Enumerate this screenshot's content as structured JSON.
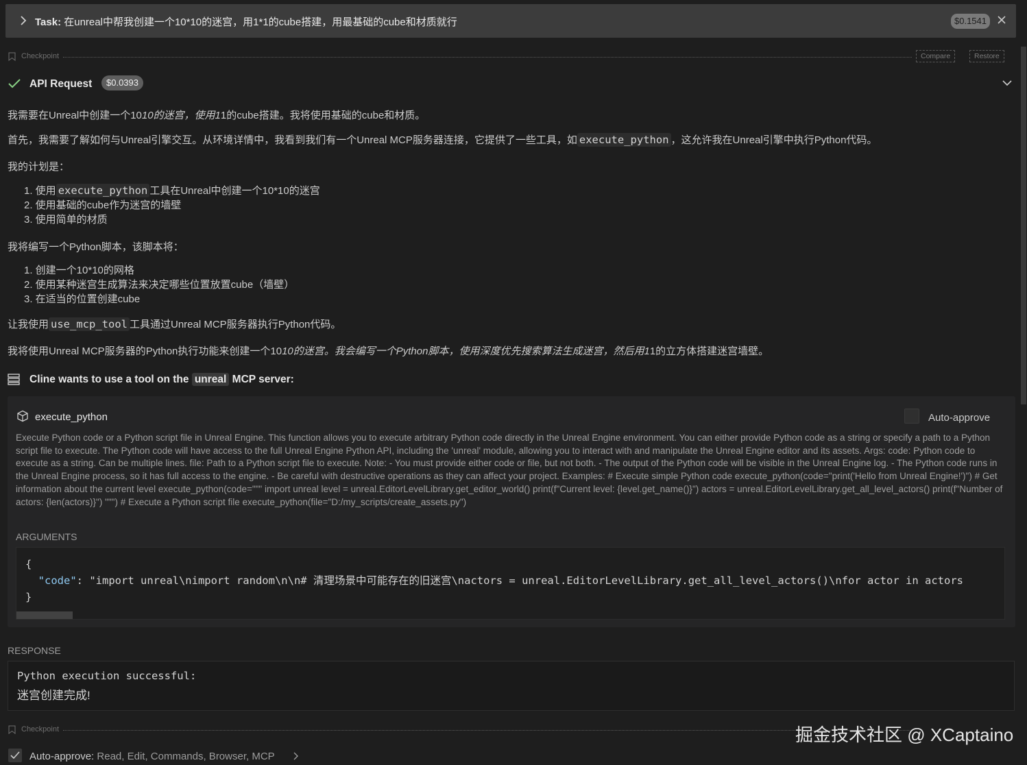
{
  "task": {
    "label": "Task:",
    "text": "在unreal中帮我创建一个10*10的迷宫，用1*1的cube搭建，用最基础的cube和材质就行",
    "cost": "$0.1541"
  },
  "checkpoint": {
    "label": "Checkpoint",
    "compare": "Compare",
    "restore": "Restore"
  },
  "api_request": {
    "title": "API Request",
    "cost": "$0.0393"
  },
  "content": {
    "p1": "我需要在Unreal中创建一个10",
    "p1_italic": "10的迷宫，使用1",
    "p1_end": "1的cube搭建。我将使用基础的cube和材质。",
    "p2_start": "首先，我需要了解如何与Unreal引擎交互。从环境详情中，我看到我们有一个Unreal MCP服务器连接，它提供了一些工具，如",
    "p2_code": "execute_python",
    "p2_end": "，这允许我在Unreal引擎中执行Python代码。",
    "p3": "我的计划是：",
    "plan_1_start": "1. 使用",
    "plan_1_code": "execute_python",
    "plan_1_end": "工具在Unreal中创建一个10*10的迷宫",
    "plan_2": "2. 使用基础的cube作为迷宫的墙壁",
    "plan_3": "3. 使用简单的材质",
    "p4": "我将编写一个Python脚本，该脚本将：",
    "script_1": "1. 创建一个10*10的网格",
    "script_2": "2. 使用某种迷宫生成算法来决定哪些位置放置cube（墙壁）",
    "script_3": "3. 在适当的位置创建cube",
    "p5_start": "让我使用",
    "p5_code": "use_mcp_tool",
    "p5_end": "工具通过Unreal MCP服务器执行Python代码。",
    "p6_start": "我将使用Unreal MCP服务器的Python执行功能来创建一个10",
    "p6_italic": "10的迷宫。我会编写一个Python脚本，使用深度优先搜索算法生成迷宫，然后用1",
    "p6_end": "1的立方体搭建迷宫墙壁。"
  },
  "tool_use": {
    "prefix": "Cline wants to use a tool on the",
    "server": "unreal",
    "suffix": "MCP server:",
    "tool_name": "execute_python",
    "auto_approve_label": "Auto-approve",
    "description": "Execute Python code or a Python script file in Unreal Engine. This function allows you to execute arbitrary Python code directly in the Unreal Engine environment. You can either provide Python code as a string or specify a path to a Python script file to execute. The Python code will have access to the full Unreal Engine Python API, including the 'unreal' module, allowing you to interact with and manipulate the Unreal Engine editor and its assets. Args: code: Python code to execute as a string. Can be multiple lines. file: Path to a Python script file to execute. Note: - You must provide either code or file, but not both. - The output of the Python code will be visible in the Unreal Engine log. - The Python code runs in the Unreal Engine process, so it has full access to the engine. - Be careful with destructive operations as they can affect your project. Examples: # Execute simple Python code execute_python(code=\"print('Hello from Unreal Engine!')\") # Get information about the current level execute_python(code=\"\"\" import unreal level = unreal.EditorLevelLibrary.get_editor_world() print(f\"Current level: {level.get_name()}\") actors = unreal.EditorLevelLibrary.get_all_level_actors() print(f\"Number of actors: {len(actors)}\") \"\"\") # Execute a Python script file execute_python(file=\"D:/my_scripts/create_assets.py\")",
    "arguments_label": "ARGUMENTS",
    "args_open": "{",
    "args_key": "\"code\"",
    "args_value": ": \"import unreal\\nimport random\\n\\n# 清理场景中可能存在的旧迷宫\\nactors = unreal.EditorLevelLibrary.get_all_level_actors()\\nfor actor in actors",
    "args_close": "}"
  },
  "response": {
    "label": "RESPONSE",
    "line1": "Python execution successful:",
    "line2": "迷宫创建完成!"
  },
  "footer": {
    "auto_approve_label": "Auto-approve:",
    "auto_approve_items": "Read, Edit, Commands, Browser, MCP"
  },
  "watermark": "掘金技术社区 @ XCaptaino",
  "colors": {
    "background": "#1e1e1e",
    "success_check": "#89d185",
    "task_bar": "#3c3c3c"
  }
}
